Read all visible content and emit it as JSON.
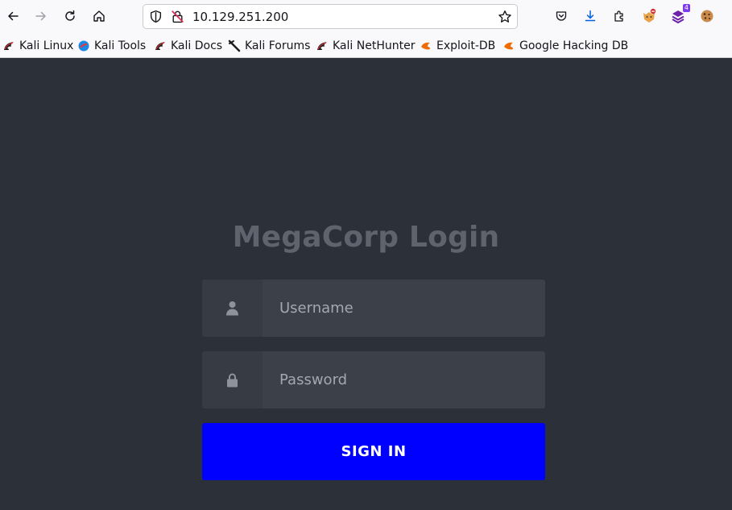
{
  "browser": {
    "url": "10.129.251.200",
    "extension_badge": "4",
    "bookmarks": [
      {
        "label": "Kali Linux",
        "icon": "kali-dragon-icon"
      },
      {
        "label": "Kali Tools",
        "icon": "kali-tools-icon"
      },
      {
        "label": "Kali Docs",
        "icon": "kali-dragon-icon"
      },
      {
        "label": "Kali Forums",
        "icon": "kali-forums-icon"
      },
      {
        "label": "Kali NetHunter",
        "icon": "kali-dragon-icon"
      },
      {
        "label": "Exploit-DB",
        "icon": "exploit-db-icon"
      },
      {
        "label": "Google Hacking DB",
        "icon": "exploit-db-icon"
      }
    ]
  },
  "login": {
    "title": "MegaCorp Login",
    "username_placeholder": "Username",
    "password_placeholder": "Password",
    "submit_label": "SIGN IN"
  },
  "colors": {
    "page_background": "#2c3038",
    "title": "#5e646d",
    "input_background": "#3b4049",
    "addon_background": "#363b44",
    "button": "#0000ff",
    "button_text": "#ffffff"
  }
}
